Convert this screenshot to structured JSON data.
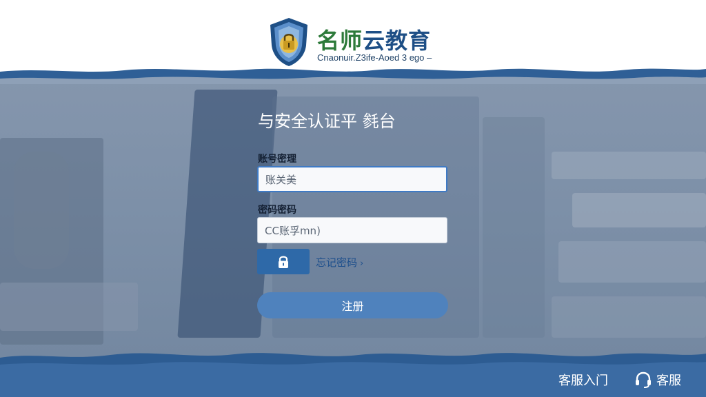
{
  "brand": {
    "name_part1": "名师",
    "name_part2": "云教育",
    "tagline": "Cnaonuir.Z3ife-Aoed 3 ego –"
  },
  "login": {
    "title": "与安全认证平 毵台",
    "account_label": "账号密理",
    "account_value": "账关美",
    "password_label": "密码密码",
    "password_value": "CC账孚mn)",
    "forgot_label": "忘记密码",
    "forgot_chevron": "›",
    "register_label": "注册"
  },
  "footer": {
    "entry_label": "客服入门",
    "support_label": "客服"
  },
  "colors": {
    "primary": "#2e69a8",
    "register": "#4f82bd",
    "background": "#7d90a8"
  },
  "icons": [
    "shield-lock-icon",
    "lock-icon",
    "headset-icon"
  ]
}
